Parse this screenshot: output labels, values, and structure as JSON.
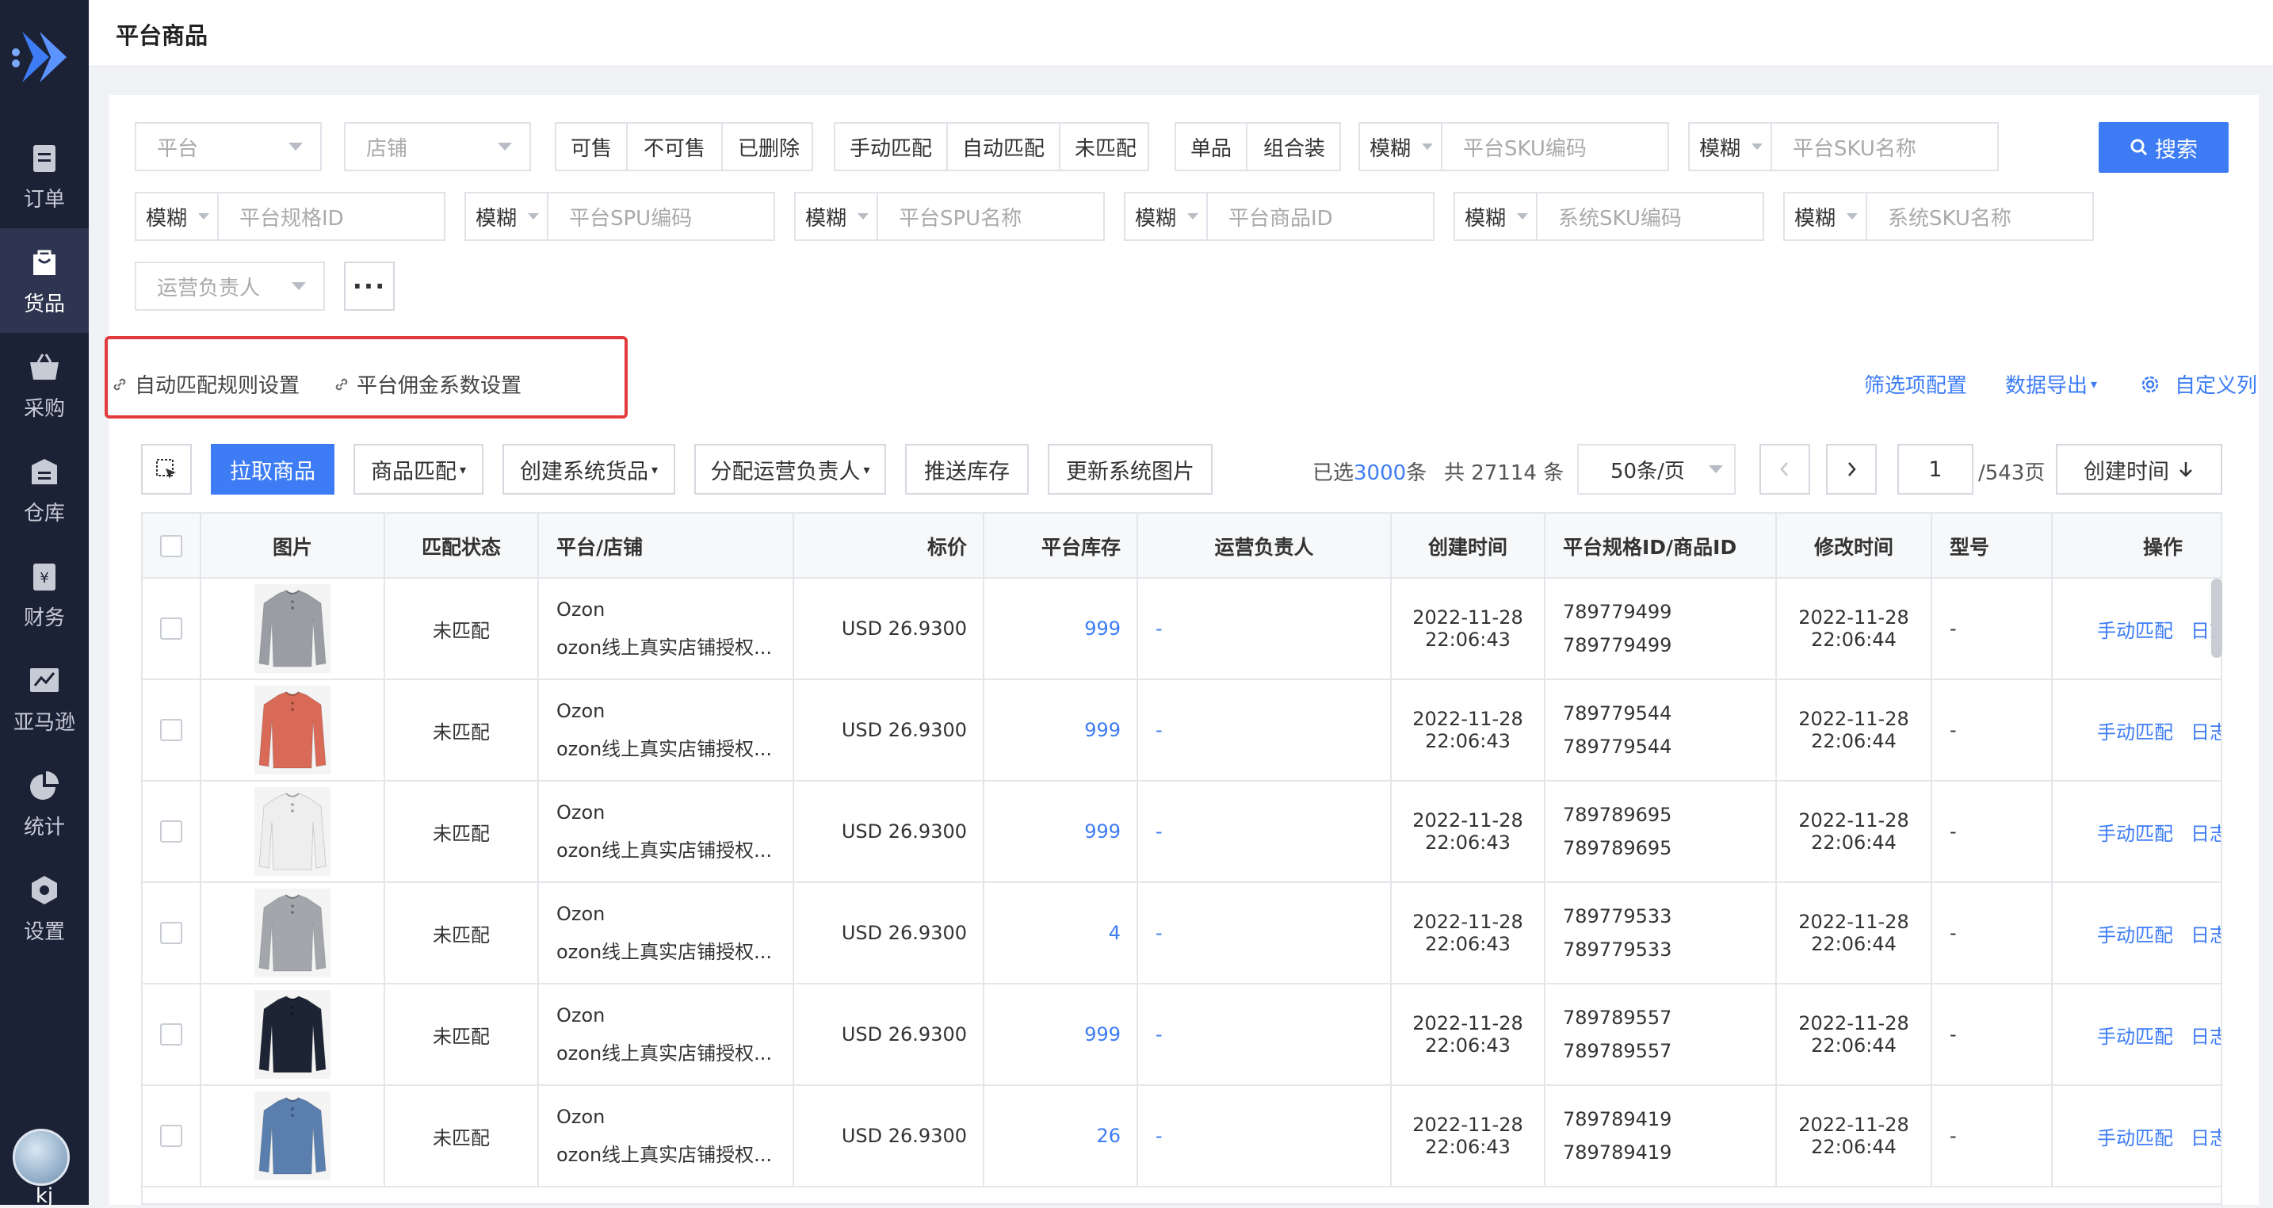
{
  "app": {
    "page_title": "平台商品"
  },
  "sidebar": {
    "items": [
      {
        "label": "订单",
        "icon": "order-icon"
      },
      {
        "label": "货品",
        "icon": "goods-icon"
      },
      {
        "label": "采购",
        "icon": "basket-icon"
      },
      {
        "label": "仓库",
        "icon": "warehouse-icon"
      },
      {
        "label": "财务",
        "icon": "finance-icon"
      },
      {
        "label": "亚马逊",
        "icon": "chart-icon"
      },
      {
        "label": "统计",
        "icon": "pie-icon"
      },
      {
        "label": "设置",
        "icon": "gear-icon"
      }
    ],
    "active": "货品",
    "user_name": "kj"
  },
  "filters": {
    "platform_placeholder": "平台",
    "store_placeholder": "店铺",
    "sale_status": [
      "可售",
      "不可售",
      "已删除"
    ],
    "match_status": [
      "手动匹配",
      "自动匹配",
      "未匹配"
    ],
    "product_type": [
      "单品",
      "组合装"
    ],
    "mode_label": "模糊",
    "fields": {
      "platform_sku_code": "平台SKU编码",
      "platform_sku_name": "平台SKU名称",
      "platform_spec_id": "平台规格ID",
      "platform_spu_code": "平台SPU编码",
      "platform_spu_name": "平台SPU名称",
      "platform_product_id": "平台商品ID",
      "system_sku_code": "系统SKU编码",
      "system_sku_name": "系统SKU名称"
    },
    "operator_placeholder": "运营负责人",
    "more_label": "···",
    "search_label": "搜索"
  },
  "links": {
    "auto_match_rules": "自动匹配规则设置",
    "commission_settings": "平台佣金系数设置",
    "filter_config": "筛选项配置",
    "data_export": "数据导出",
    "custom_columns": "自定义列"
  },
  "toolbar": {
    "pull_products": "拉取商品",
    "product_match": "商品匹配",
    "create_system_goods": "创建系统货品",
    "assign_operator": "分配运营负责人",
    "push_stock": "推送库存",
    "update_images": "更新系统图片",
    "selected_prefix": "已选",
    "selected_count": "3000",
    "selected_suffix": "条",
    "total_text": "共 27114 条",
    "page_size": "50条/页",
    "current_page": "1",
    "total_pages": "/543页",
    "sort_label": "创建时间"
  },
  "table": {
    "headers": {
      "image": "图片",
      "match_status": "匹配状态",
      "platform_store": "平台/店铺",
      "price": "标价",
      "stock": "平台库存",
      "operator": "运营负责人",
      "created": "创建时间",
      "spec_product_id": "平台规格ID/商品ID",
      "modified": "修改时间",
      "model": "型号",
      "actions": "操作"
    },
    "rows": [
      {
        "shirt_color": "#9a9ea4",
        "match_status": "未匹配",
        "platform": "Ozon",
        "store": "ozon线上真实店铺授权...",
        "price": "USD 26.9300",
        "stock": "999",
        "operator": "-",
        "created_date": "2022-11-28",
        "created_time": "22:06:43",
        "spec_id": "789779499",
        "product_id": "789779499",
        "modified_date": "2022-11-28",
        "modified_time": "22:06:44",
        "model": "-",
        "action_match": "手动匹配",
        "action_log": "日志"
      },
      {
        "shirt_color": "#d96a57",
        "match_status": "未匹配",
        "platform": "Ozon",
        "store": "ozon线上真实店铺授权...",
        "price": "USD 26.9300",
        "stock": "999",
        "operator": "-",
        "created_date": "2022-11-28",
        "created_time": "22:06:43",
        "spec_id": "789779544",
        "product_id": "789779544",
        "modified_date": "2022-11-28",
        "modified_time": "22:06:44",
        "model": "-",
        "action_match": "手动匹配",
        "action_log": "日志"
      },
      {
        "shirt_color": "#eeeeee",
        "match_status": "未匹配",
        "platform": "Ozon",
        "store": "ozon线上真实店铺授权...",
        "price": "USD 26.9300",
        "stock": "999",
        "operator": "-",
        "created_date": "2022-11-28",
        "created_time": "22:06:43",
        "spec_id": "789789695",
        "product_id": "789789695",
        "modified_date": "2022-11-28",
        "modified_time": "22:06:44",
        "model": "-",
        "action_match": "手动匹配",
        "action_log": "日志"
      },
      {
        "shirt_color": "#a3a6ab",
        "match_status": "未匹配",
        "platform": "Ozon",
        "store": "ozon线上真实店铺授权...",
        "price": "USD 26.9300",
        "stock": "4",
        "operator": "-",
        "created_date": "2022-11-28",
        "created_time": "22:06:43",
        "spec_id": "789779533",
        "product_id": "789779533",
        "modified_date": "2022-11-28",
        "modified_time": "22:06:44",
        "model": "-",
        "action_match": "手动匹配",
        "action_log": "日志"
      },
      {
        "shirt_color": "#1d2535",
        "match_status": "未匹配",
        "platform": "Ozon",
        "store": "ozon线上真实店铺授权...",
        "price": "USD 26.9300",
        "stock": "999",
        "operator": "-",
        "created_date": "2022-11-28",
        "created_time": "22:06:43",
        "spec_id": "789789557",
        "product_id": "789789557",
        "modified_date": "2022-11-28",
        "modified_time": "22:06:44",
        "model": "-",
        "action_match": "手动匹配",
        "action_log": "日志"
      },
      {
        "shirt_color": "#5a7fae",
        "match_status": "未匹配",
        "platform": "Ozon",
        "store": "ozon线上真实店铺授权...",
        "price": "USD 26.9300",
        "stock": "26",
        "operator": "-",
        "created_date": "2022-11-28",
        "created_time": "22:06:43",
        "spec_id": "789789419",
        "product_id": "789789419",
        "modified_date": "2022-11-28",
        "modified_time": "22:06:44",
        "model": "-",
        "action_match": "手动匹配",
        "action_log": "日志"
      }
    ]
  },
  "colors": {
    "accent": "#3d7cf5",
    "sidebar_bg": "#1b2236",
    "highlight_border": "#e33b3b"
  }
}
